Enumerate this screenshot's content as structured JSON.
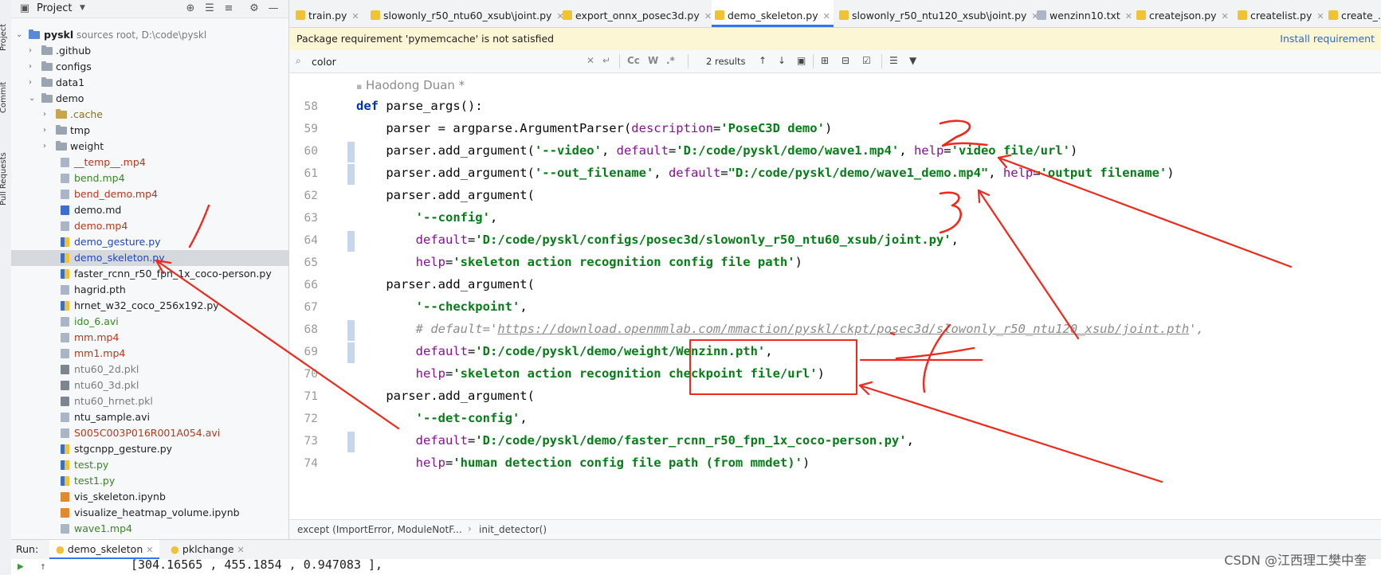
{
  "toolstrip": {
    "tabs": [
      "Project",
      "Commit",
      "Pull Requests"
    ]
  },
  "project": {
    "title": "Project",
    "root": {
      "name": "pyskl",
      "hint": "sources root, D:\\code\\pyskl"
    },
    "items": [
      {
        "label": ".github",
        "kind": "folder"
      },
      {
        "label": "configs",
        "kind": "folder"
      },
      {
        "label": "data1",
        "kind": "folder"
      },
      {
        "label": "demo",
        "kind": "folder"
      },
      {
        "label": ".cache",
        "kind": "folder"
      },
      {
        "label": "tmp",
        "kind": "folder"
      },
      {
        "label": "weight",
        "kind": "folder"
      },
      {
        "label": "__temp__.mp4",
        "kind": "file"
      },
      {
        "label": "bend.mp4",
        "kind": "file"
      },
      {
        "label": "bend_demo.mp4",
        "kind": "file"
      },
      {
        "label": "demo.md",
        "kind": "file"
      },
      {
        "label": "demo.mp4",
        "kind": "file"
      },
      {
        "label": "demo_gesture.py",
        "kind": "file"
      },
      {
        "label": "demo_skeleton.py",
        "kind": "file"
      },
      {
        "label": "faster_rcnn_r50_fpn_1x_coco-person.py",
        "kind": "file"
      },
      {
        "label": "hagrid.pth",
        "kind": "file"
      },
      {
        "label": "hrnet_w32_coco_256x192.py",
        "kind": "file"
      },
      {
        "label": "ido_6.avi",
        "kind": "file"
      },
      {
        "label": "mm.mp4",
        "kind": "file"
      },
      {
        "label": "mm1.mp4",
        "kind": "file"
      },
      {
        "label": "ntu60_2d.pkl",
        "kind": "file"
      },
      {
        "label": "ntu60_3d.pkl",
        "kind": "file"
      },
      {
        "label": "ntu60_hrnet.pkl",
        "kind": "file"
      },
      {
        "label": "ntu_sample.avi",
        "kind": "file"
      },
      {
        "label": "S005C003P016R001A054.avi",
        "kind": "file"
      },
      {
        "label": "stgcnpp_gesture.py",
        "kind": "file"
      },
      {
        "label": "test.py",
        "kind": "file"
      },
      {
        "label": "test1.py",
        "kind": "file"
      },
      {
        "label": "vis_skeleton.ipynb",
        "kind": "file"
      },
      {
        "label": "visualize_heatmap_volume.ipynb",
        "kind": "file"
      },
      {
        "label": "wave1.mp4",
        "kind": "file"
      }
    ]
  },
  "tabs": [
    {
      "label": "train.py"
    },
    {
      "label": "slowonly_r50_ntu60_xsub\\joint.py"
    },
    {
      "label": "export_onnx_posec3d.py"
    },
    {
      "label": "demo_skeleton.py",
      "active": true
    },
    {
      "label": "slowonly_r50_ntu120_xsub\\joint.py"
    },
    {
      "label": "wenzinn10.txt"
    },
    {
      "label": "createjson.py"
    },
    {
      "label": "createlist.py"
    },
    {
      "label": "create_..."
    }
  ],
  "banner": {
    "message": "Package requirement 'pymemcache' is not satisfied",
    "action": "Install requirement"
  },
  "search": {
    "query": "color",
    "results": "2 results",
    "opt_case": "Cc",
    "opt_word": "W",
    "opt_regex": ".*"
  },
  "editor": {
    "author": "Haodong Duan *",
    "line_numbers": [
      "58",
      "59",
      "60",
      "61",
      "62",
      "63",
      "64",
      "65",
      "66",
      "67",
      "68",
      "69",
      "70",
      "71",
      "72",
      "73",
      "74"
    ],
    "code": {
      "l58_def": "def",
      "l58_rest": " parse_args():",
      "l59_a": "    parser = argparse.ArgumentParser(",
      "l59_p": "description",
      "l59_b": "=",
      "l59_s": "'PoseC3D demo'",
      "l59_c": ")",
      "l60_a": "    parser.add_argument(",
      "l60_s1": "'--video'",
      "l60_b": ", ",
      "l60_p1": "default",
      "l60_c": "=",
      "l60_s2": "'D:/code/pyskl/demo/wave1.mp4'",
      "l60_d": ", ",
      "l60_p2": "help",
      "l60_e": "=",
      "l60_s3": "'video file/url'",
      "l60_f": ")",
      "l61_a": "    parser.add_argument(",
      "l61_s1": "'--out_filename'",
      "l61_b": ", ",
      "l61_p1": "default",
      "l61_c": "=",
      "l61_s2": "\"D:/code/pyskl/demo/wave1_demo.mp4\"",
      "l61_d": ", ",
      "l61_p2": "help",
      "l61_e": "=",
      "l61_s3": "'output filename'",
      "l61_f": ")",
      "l62": "    parser.add_argument(",
      "l63_s": "'--config'",
      "l63_b": ",",
      "l64_p": "default",
      "l64_b": "=",
      "l64_s": "'D:/code/pyskl/configs/posec3d/slowonly_r50_ntu60_xsub/joint.py'",
      "l64_c": ",",
      "l65_p": "help",
      "l65_b": "=",
      "l65_s": "'skeleton action recognition config file path'",
      "l65_c": ")",
      "l66": "    parser.add_argument(",
      "l67_s": "'--checkpoint'",
      "l67_b": ",",
      "l68_a": "# default='",
      "l68_u": "https://download.openmmlab.com/mmaction/pyskl/ckpt/posec3d/slowonly_r50_ntu120_xsub/joint.pth",
      "l68_b": "',",
      "l69_p": "default",
      "l69_b": "=",
      "l69_s": "'D:/code/pyskl/demo/weight/Wenzinn.pth'",
      "l69_c": ",",
      "l70_p": "help",
      "l70_b": "=",
      "l70_s": "'skeleton action recognition checkpoint file/url'",
      "l70_c": ")",
      "l71": "    parser.add_argument(",
      "l72_s": "'--det-config'",
      "l72_b": ",",
      "l73_p": "default",
      "l73_b": "=",
      "l73_s": "'D:/code/pyskl/demo/faster_rcnn_r50_fpn_1x_coco-person.py'",
      "l73_c": ",",
      "l74_p": "help",
      "l74_b": "=",
      "l74_s": "'human detection config file path (from mmdet)'",
      "l74_c": ")"
    }
  },
  "breadcrumb": {
    "first": "except (ImportError, ModuleNotF...",
    "second": "init_detector()"
  },
  "run": {
    "label": "Run:",
    "tabs": [
      "demo_skeleton",
      "pklchange"
    ],
    "console_line": "[304.16565  , 455.1854   ,   0.947083  ],"
  },
  "watermark": "CSDN @江西理工樊中奎",
  "annotations": {
    "numbers": [
      "1",
      "2",
      "3",
      "4"
    ],
    "color": "#ee2a1c"
  },
  "colors": {
    "accent": "#3574f0",
    "string": "#067d17",
    "keyword": "#0033b3",
    "param": "#871094",
    "comment": "#8c8c8c",
    "selection": "#d5d8dd",
    "annotation": "#ee2a1c"
  }
}
